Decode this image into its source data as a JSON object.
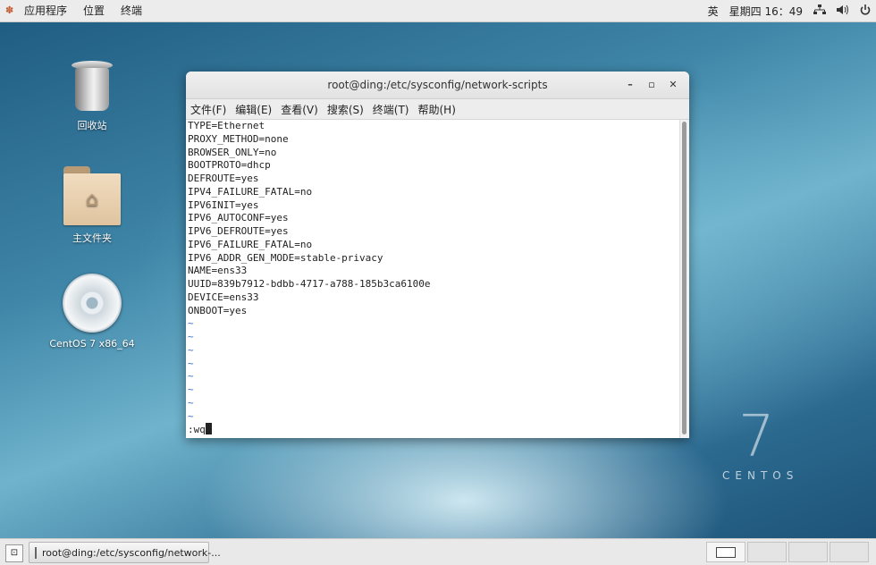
{
  "topbar": {
    "applications": "应用程序",
    "places": "位置",
    "terminal": "终端",
    "input_method": "英",
    "clock": "星期四 16：49",
    "network_icon": "network-icon",
    "volume_icon": "volume-icon",
    "power_icon": "power-icon"
  },
  "desktop": {
    "trash_label": "回收站",
    "home_label": "主文件夹",
    "dvd_label": "CentOS 7 x86_64",
    "brand_number": "7",
    "brand_word": "CENTOS"
  },
  "terminal": {
    "title": "root@ding:/etc/sysconfig/network-scripts",
    "menu": [
      "文件(F)",
      "编辑(E)",
      "查看(V)",
      "搜索(S)",
      "终端(T)",
      "帮助(H)"
    ],
    "lines": [
      "TYPE=Ethernet",
      "PROXY_METHOD=none",
      "BROWSER_ONLY=no",
      "BOOTPROTO=dhcp",
      "DEFROUTE=yes",
      "IPV4_FAILURE_FATAL=no",
      "IPV6INIT=yes",
      "IPV6_AUTOCONF=yes",
      "IPV6_DEFROUTE=yes",
      "IPV6_FAILURE_FATAL=no",
      "IPV6_ADDR_GEN_MODE=stable-privacy",
      "NAME=ens33",
      "UUID=839b7912-bdbb-4717-a788-185b3ca6100e",
      "DEVICE=ens33",
      "ONBOOT=yes"
    ],
    "tildes": [
      "~",
      "~",
      "~",
      "~",
      "~",
      "~",
      "~",
      "~"
    ],
    "command": ":wq"
  },
  "taskbar": {
    "task_label": "root@ding:/etc/sysconfig/network-..."
  }
}
